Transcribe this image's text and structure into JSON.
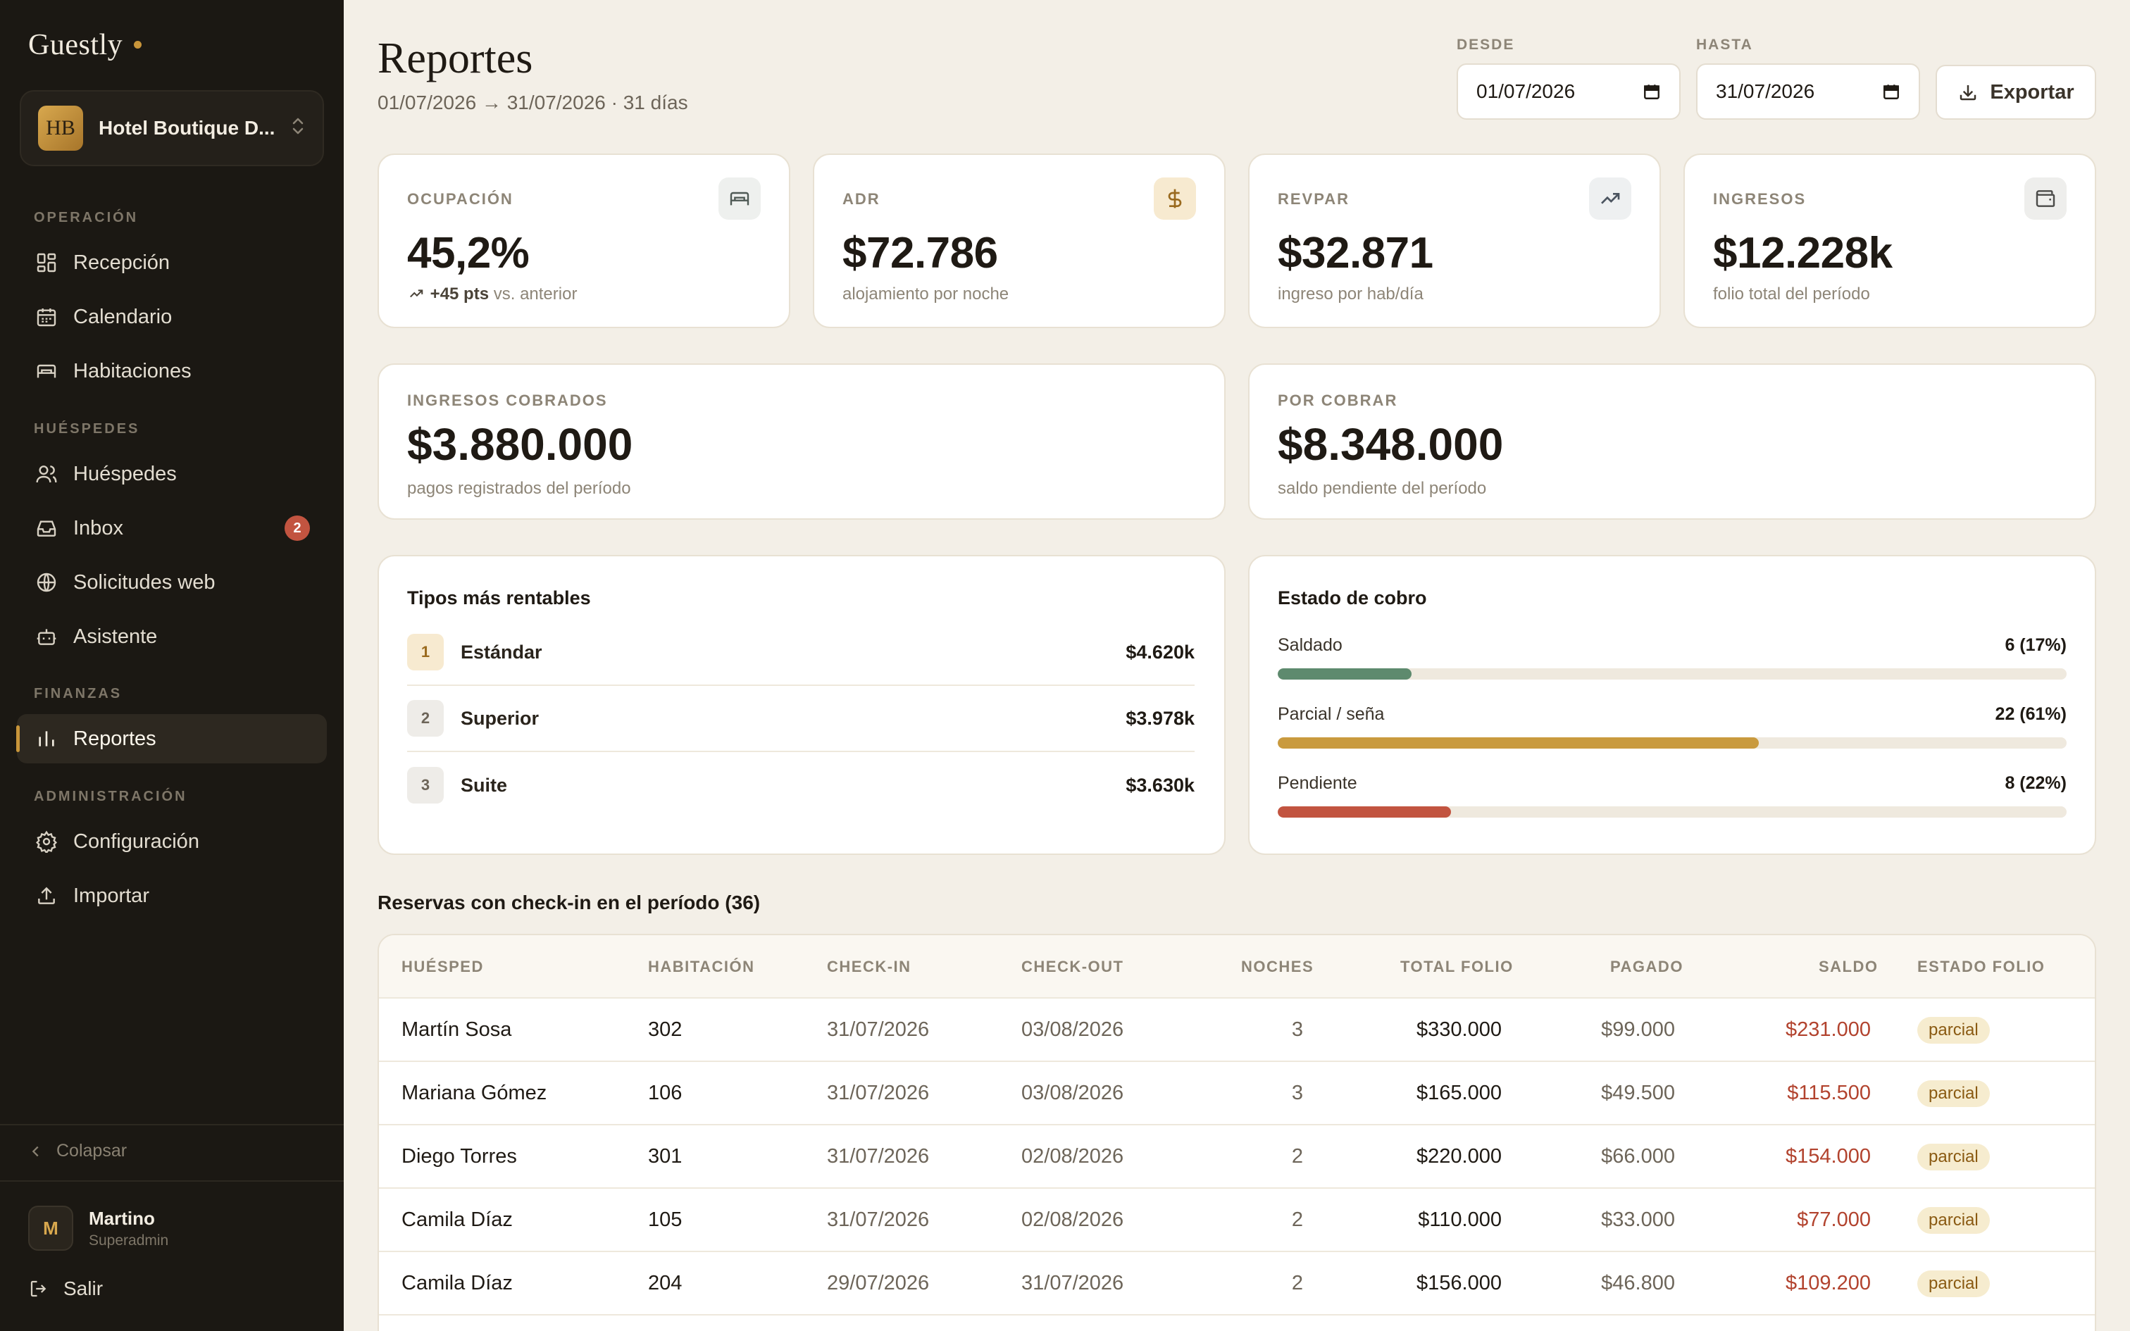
{
  "sidebar": {
    "brand": "Guestly",
    "hotel": {
      "logo": "HB",
      "name": "Hotel Boutique D..."
    },
    "sections": [
      {
        "label": "OPERACIÓN"
      },
      {
        "label": "HUÉSPEDES"
      },
      {
        "label": "FINANZAS"
      },
      {
        "label": "ADMINISTRACIÓN"
      }
    ],
    "items": [
      {
        "label": "Recepción",
        "icon": "grid-icon"
      },
      {
        "label": "Calendario",
        "icon": "calendar-icon"
      },
      {
        "label": "Habitaciones",
        "icon": "bed-icon"
      },
      {
        "label": "Huéspedes",
        "icon": "users-icon"
      },
      {
        "label": "Inbox",
        "icon": "inbox-icon",
        "badge": "2"
      },
      {
        "label": "Solicitudes web",
        "icon": "globe-icon"
      },
      {
        "label": "Asistente",
        "icon": "bot-icon"
      },
      {
        "label": "Reportes",
        "icon": "bar-chart-icon",
        "active": true
      },
      {
        "label": "Configuración",
        "icon": "gear-icon"
      },
      {
        "label": "Importar",
        "icon": "upload-icon"
      }
    ],
    "collapse_label": "Colapsar",
    "user": {
      "initial": "M",
      "name": "Martino",
      "role": "Superadmin"
    },
    "logout_label": "Salir"
  },
  "header": {
    "title": "Reportes",
    "subtitle": "01/07/2026 → 31/07/2026 · 31 días",
    "from_label": "DESDE",
    "from_value": "01/07/2026",
    "to_label": "HASTA",
    "to_value": "31/07/2026",
    "export_label": "Exportar"
  },
  "kpis": [
    {
      "label": "OCUPACIÓN",
      "value": "45,2%",
      "sub_strong": "+45 pts",
      "sub": "vs. anterior",
      "icon": "bed-icon"
    },
    {
      "label": "ADR",
      "value": "$72.786",
      "sub": "alojamiento por noche",
      "icon": "dollar-icon"
    },
    {
      "label": "REVPAR",
      "value": "$32.871",
      "sub": "ingreso por hab/día",
      "icon": "trending-up-icon"
    },
    {
      "label": "INGRESOS",
      "value": "$12.228k",
      "sub": "folio total del período",
      "icon": "wallet-icon"
    }
  ],
  "totals": [
    {
      "label": "INGRESOS COBRADOS",
      "value": "$3.880.000",
      "sub": "pagos registrados del período"
    },
    {
      "label": "POR COBRAR",
      "value": "$8.348.000",
      "sub": "saldo pendiente del período"
    }
  ],
  "ranking": {
    "title": "Tipos más rentables",
    "items": [
      {
        "rank": "1",
        "name": "Estándar",
        "value": "$4.620k"
      },
      {
        "rank": "2",
        "name": "Superior",
        "value": "$3.978k"
      },
      {
        "rank": "3",
        "name": "Suite",
        "value": "$3.630k"
      }
    ]
  },
  "collection": {
    "title": "Estado de cobro",
    "items": [
      {
        "label": "Saldado",
        "value": "6 (17%)",
        "fraction": 0.17,
        "color": "#5e8a6e"
      },
      {
        "label": "Parcial / seña",
        "value": "22 (61%)",
        "fraction": 0.61,
        "color": "#c99a3e"
      },
      {
        "label": "Pendiente",
        "value": "8 (22%)",
        "fraction": 0.22,
        "color": "#c25440"
      }
    ]
  },
  "reservations": {
    "title": "Reservas con check-in en el período (36)",
    "columns": [
      "HUÉSPED",
      "HABITACIÓN",
      "CHECK-IN",
      "CHECK-OUT",
      "NOCHES",
      "TOTAL FOLIO",
      "PAGADO",
      "SALDO",
      "ESTADO FOLIO"
    ],
    "rows": [
      {
        "guest": "Martín Sosa",
        "room": "302",
        "checkin": "31/07/2026",
        "checkout": "03/08/2026",
        "nights": "3",
        "total": "$330.000",
        "paid": "$99.000",
        "balance": "$231.000",
        "status": "parcial"
      },
      {
        "guest": "Mariana Gómez",
        "room": "106",
        "checkin": "31/07/2026",
        "checkout": "03/08/2026",
        "nights": "3",
        "total": "$165.000",
        "paid": "$49.500",
        "balance": "$115.500",
        "status": "parcial"
      },
      {
        "guest": "Diego Torres",
        "room": "301",
        "checkin": "31/07/2026",
        "checkout": "02/08/2026",
        "nights": "2",
        "total": "$220.000",
        "paid": "$66.000",
        "balance": "$154.000",
        "status": "parcial"
      },
      {
        "guest": "Camila Díaz",
        "room": "105",
        "checkin": "31/07/2026",
        "checkout": "02/08/2026",
        "nights": "2",
        "total": "$110.000",
        "paid": "$33.000",
        "balance": "$77.000",
        "status": "parcial"
      },
      {
        "guest": "Camila Díaz",
        "room": "204",
        "checkin": "29/07/2026",
        "checkout": "31/07/2026",
        "nights": "2",
        "total": "$156.000",
        "paid": "$46.800",
        "balance": "$109.200",
        "status": "parcial"
      }
    ]
  }
}
